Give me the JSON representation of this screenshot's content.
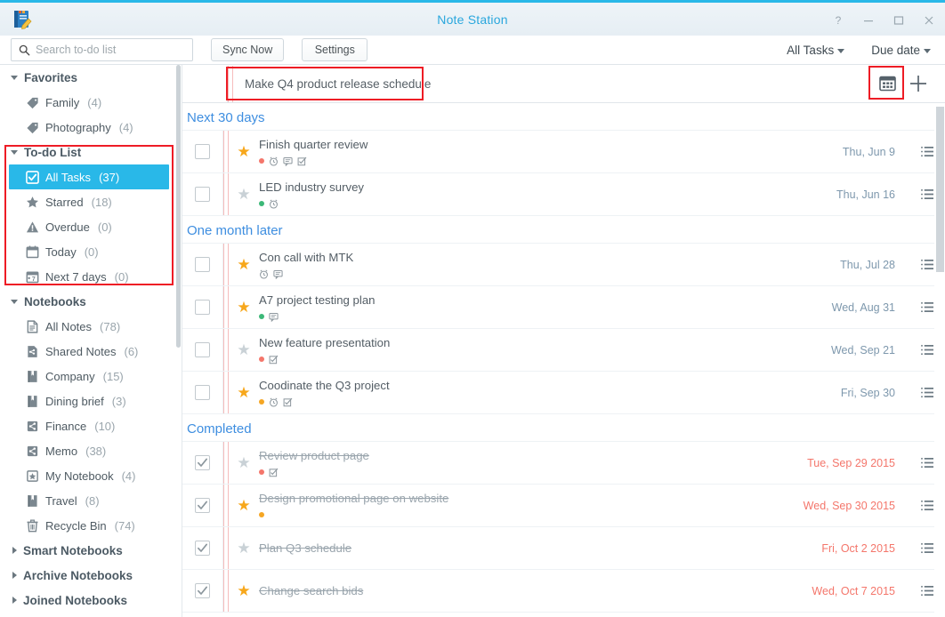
{
  "window": {
    "title": "Note Station",
    "controls": [
      {
        "name": "help-button",
        "glyph": "?"
      },
      {
        "name": "minimize-button",
        "glyph": "–"
      },
      {
        "name": "maximize-button",
        "glyph": "□"
      },
      {
        "name": "close-button",
        "glyph": "×"
      }
    ],
    "app_icon": "notebook-pencil-icon",
    "accent_color": "#29b8e8"
  },
  "toolbar": {
    "search_placeholder": "Search to-do list",
    "search_value": "",
    "search_icon": "search-icon",
    "sync_label": "Sync Now",
    "settings_label": "Settings",
    "filter_dropdown": "All Tasks",
    "sort_dropdown": "Due date"
  },
  "sidebar": {
    "groups": [
      {
        "name": "favorites",
        "label": "Favorites",
        "expanded": true,
        "items": [
          {
            "label": "Family",
            "count": "(4)",
            "icon": "tag-icon"
          },
          {
            "label": "Photography",
            "count": "(4)",
            "icon": "tag-icon"
          }
        ]
      },
      {
        "name": "todo-list",
        "label": "To-do List",
        "expanded": true,
        "highlighted": true,
        "items": [
          {
            "label": "All Tasks",
            "count": "(37)",
            "icon": "checkbox-icon",
            "active": true
          },
          {
            "label": "Starred",
            "count": "(18)",
            "icon": "star-icon"
          },
          {
            "label": "Overdue",
            "count": "(0)",
            "icon": "warning-icon"
          },
          {
            "label": "Today",
            "count": "(0)",
            "icon": "calendar-icon"
          },
          {
            "label": "Next 7 days",
            "count": "(0)",
            "icon": "calendar-7-icon"
          }
        ]
      },
      {
        "name": "notebooks",
        "label": "Notebooks",
        "expanded": true,
        "items": [
          {
            "label": "All Notes",
            "count": "(78)",
            "icon": "notes-icon"
          },
          {
            "label": "Shared Notes",
            "count": "(6)",
            "icon": "shared-notes-icon"
          },
          {
            "label": "Company",
            "count": "(15)",
            "icon": "notebook-icon"
          },
          {
            "label": "Dining brief",
            "count": "(3)",
            "icon": "notebook-icon"
          },
          {
            "label": "Finance",
            "count": "(10)",
            "icon": "share-icon"
          },
          {
            "label": "Memo",
            "count": "(38)",
            "icon": "share-icon"
          },
          {
            "label": "My Notebook",
            "count": "(4)",
            "icon": "star-notebook-icon"
          },
          {
            "label": "Travel",
            "count": "(8)",
            "icon": "notebook-icon"
          },
          {
            "label": "Recycle Bin",
            "count": "(74)",
            "icon": "trash-icon"
          }
        ]
      }
    ],
    "collapsed_groups": [
      {
        "label": "Smart Notebooks"
      },
      {
        "label": "Archive Notebooks"
      },
      {
        "label": "Joined Notebooks"
      }
    ]
  },
  "main": {
    "new_task_value": "Make Q4 product release schedule",
    "new_task_placeholder": "",
    "grid_view_icon": "calendar-grid-icon",
    "add_icon": "plus-icon",
    "groups": [
      {
        "title": "Next 30 days",
        "tasks": [
          {
            "title": "Finish quarter review",
            "date": "Thu, Jun 9",
            "checked": false,
            "starred": true,
            "done": false,
            "priority_color": "#f4766b",
            "badges": [
              "priority-dot",
              "alarm-icon",
              "comment-icon",
              "checklist-icon"
            ]
          },
          {
            "title": "LED industry survey",
            "date": "Thu, Jun 16",
            "checked": false,
            "starred": false,
            "done": false,
            "priority_color": "#3cb878",
            "badges": [
              "priority-dot",
              "alarm-icon"
            ]
          }
        ]
      },
      {
        "title": "One month later",
        "tasks": [
          {
            "title": "Con call with MTK",
            "date": "Thu, Jul 28",
            "checked": false,
            "starred": true,
            "done": false,
            "priority_color": "",
            "badges": [
              "alarm-icon",
              "comment-icon"
            ]
          },
          {
            "title": "A7 project testing plan",
            "date": "Wed, Aug 31",
            "checked": false,
            "starred": true,
            "done": false,
            "priority_color": "#3cb878",
            "badges": [
              "priority-dot",
              "comment-icon"
            ]
          },
          {
            "title": "New feature presentation",
            "date": "Wed, Sep 21",
            "checked": false,
            "starred": false,
            "done": false,
            "priority_color": "#f4766b",
            "badges": [
              "priority-dot",
              "checklist-icon"
            ]
          },
          {
            "title": "Coodinate the Q3 project",
            "date": "Fri, Sep 30",
            "checked": false,
            "starred": true,
            "done": false,
            "priority_color": "#f5a623",
            "badges": [
              "priority-dot",
              "alarm-icon",
              "checklist-icon"
            ]
          }
        ]
      },
      {
        "title": "Completed",
        "tasks": [
          {
            "title": "Review product page",
            "date": "Tue, Sep 29 2015",
            "checked": true,
            "starred": false,
            "done": true,
            "priority_color": "#f4766b",
            "badges": [
              "priority-dot",
              "checklist-icon"
            ]
          },
          {
            "title": "Design promotional page on website",
            "date": "Wed, Sep 30 2015",
            "checked": true,
            "starred": true,
            "done": true,
            "priority_color": "#f5a623",
            "badges": [
              "priority-dot"
            ]
          },
          {
            "title": "Plan Q3 schedule",
            "date": "Fri, Oct 2 2015",
            "checked": true,
            "starred": false,
            "done": true,
            "priority_color": "",
            "badges": []
          },
          {
            "title": "Change search bids",
            "date": "Wed, Oct 7 2015",
            "checked": true,
            "starred": true,
            "done": true,
            "priority_color": "",
            "badges": []
          }
        ]
      }
    ]
  }
}
